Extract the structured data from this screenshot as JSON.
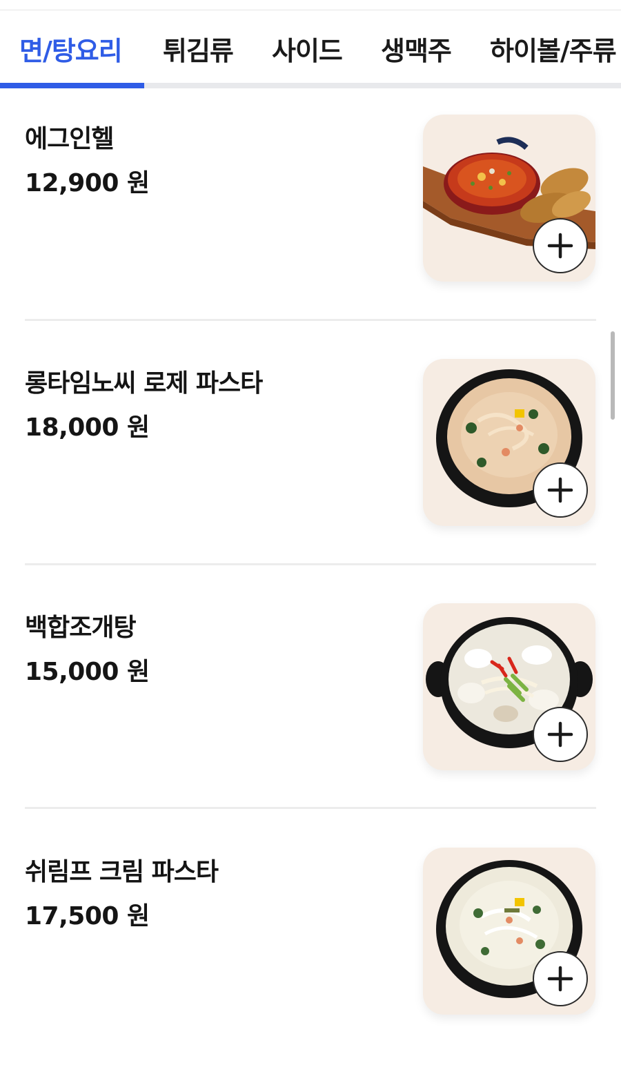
{
  "tabs": [
    {
      "label": "면/탕요리",
      "active": true
    },
    {
      "label": "튀김류",
      "active": false
    },
    {
      "label": "사이드",
      "active": false
    },
    {
      "label": "생맥주",
      "active": false
    },
    {
      "label": "하이볼/주류",
      "active": false
    }
  ],
  "colors": {
    "accent": "#2f5ce6",
    "text": "#151515",
    "thumb_bg": "#f6ece3",
    "divider": "#ececec"
  },
  "menu": {
    "items": [
      {
        "name": "에그인헬",
        "price": "12,900 원",
        "image_icon": "shakshuka-skillet-icon",
        "add_icon": "plus-icon"
      },
      {
        "name": "롱타임노씨 로제 파스타",
        "price": "18,000 원",
        "image_icon": "rose-pasta-bowl-icon",
        "add_icon": "plus-icon"
      },
      {
        "name": "백합조개탕",
        "price": "15,000 원",
        "image_icon": "clam-soup-pot-icon",
        "add_icon": "plus-icon"
      },
      {
        "name": "쉬림프 크림 파스타",
        "price": "17,500 원",
        "image_icon": "cream-pasta-bowl-icon",
        "add_icon": "plus-icon"
      }
    ]
  }
}
